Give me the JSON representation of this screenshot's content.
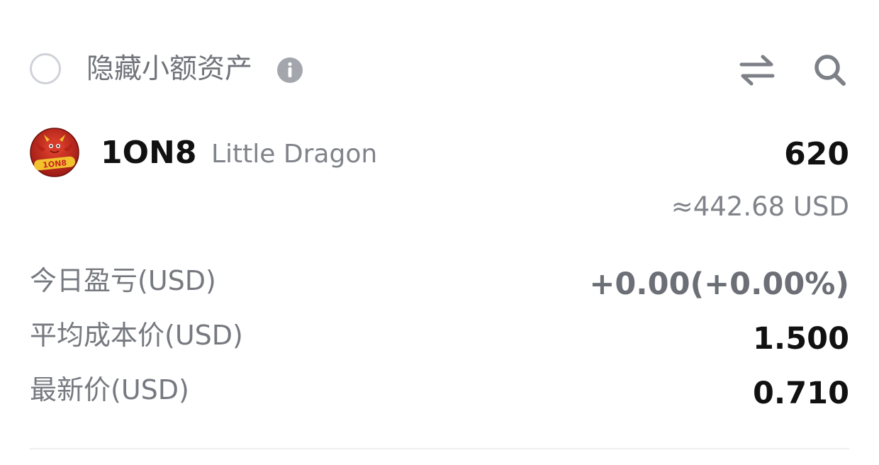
{
  "filter": {
    "hide_small_label": "隐藏小额资产",
    "checked": false
  },
  "icons": {
    "info": "info-icon",
    "swap": "swap-icon",
    "search": "search-icon",
    "logo": "coin-logo-dragon"
  },
  "asset": {
    "symbol": "1ON8",
    "name": "Little Dragon",
    "quantity": "620",
    "usd_value": "≈442.68 USD"
  },
  "stats": [
    {
      "label": "今日盈亏(USD)",
      "value": "+0.00(+0.00%)"
    },
    {
      "label": "平均成本价(USD)",
      "value": "1.500"
    },
    {
      "label": "最新价(USD)",
      "value": "0.710"
    }
  ],
  "colors": {
    "text_primary": "#111111",
    "text_secondary": "#808389",
    "icon_gray": "#9a9da3",
    "logo_red": "#c8261e",
    "logo_gold": "#f2c12e"
  }
}
